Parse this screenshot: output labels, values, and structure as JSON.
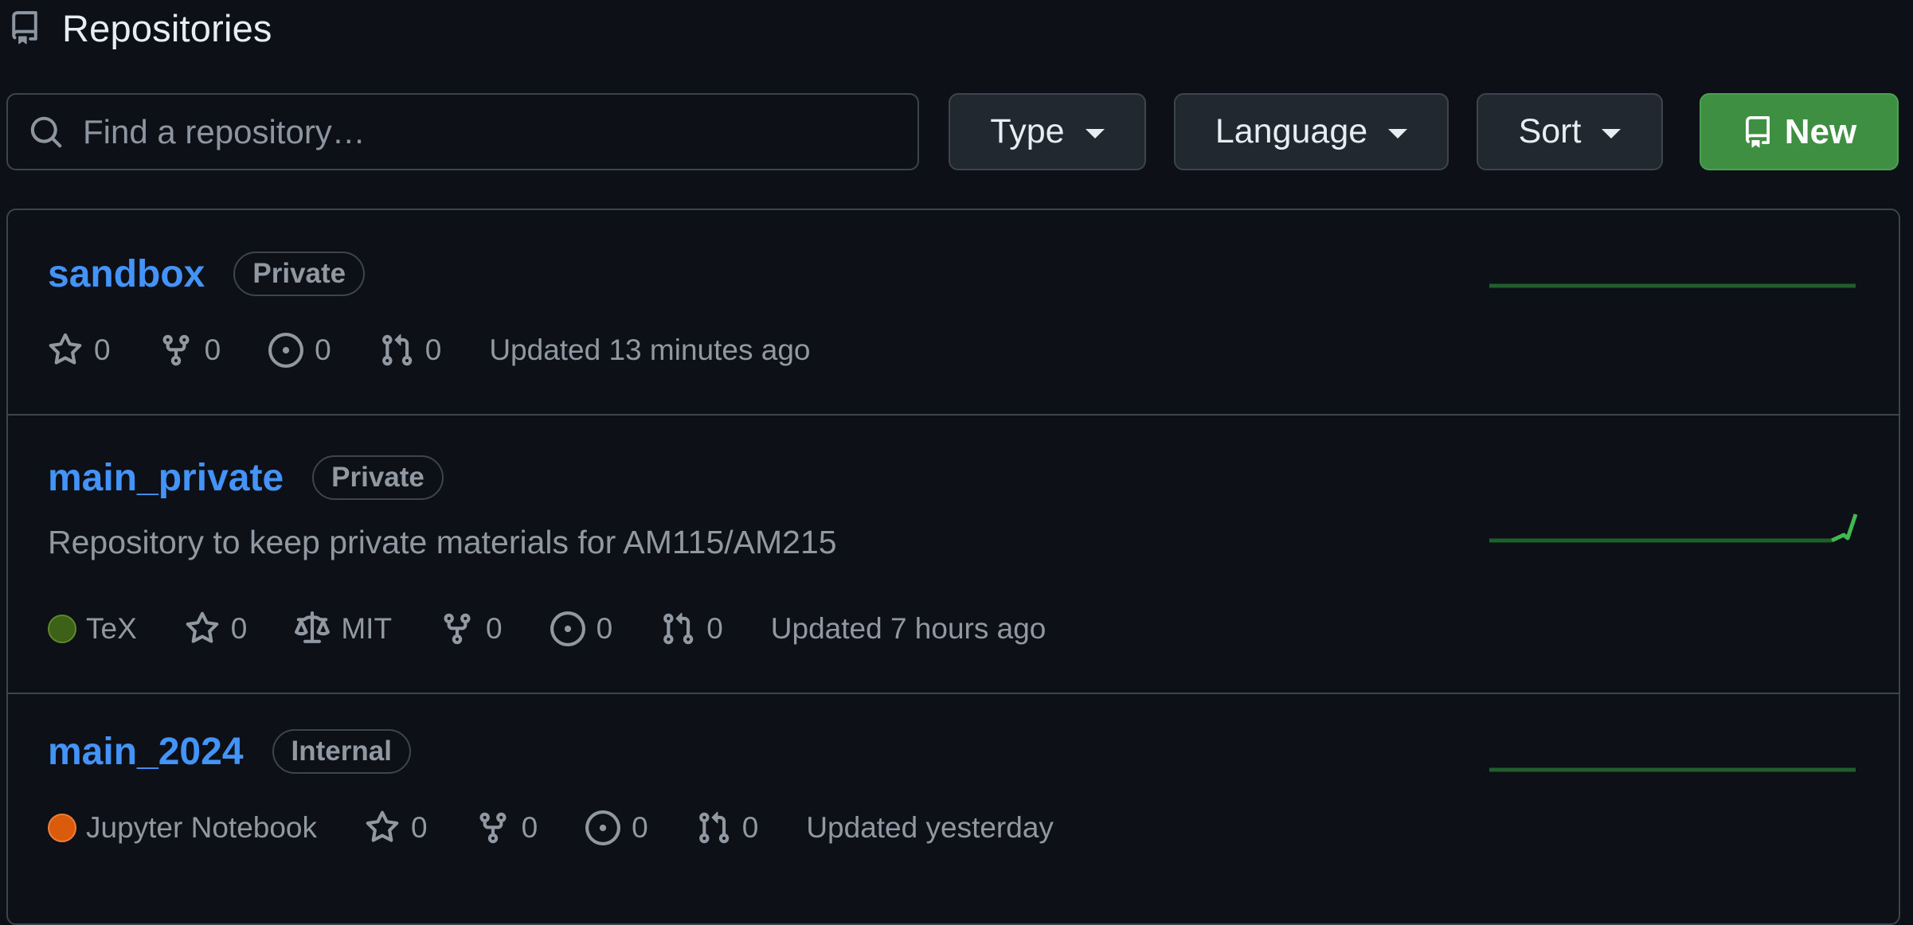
{
  "header": {
    "title": "Repositories",
    "icon": "repo-icon"
  },
  "search": {
    "placeholder": "Find a repository…",
    "value": "",
    "icon": "search-icon"
  },
  "filters": {
    "type_label": "Type",
    "language_label": "Language",
    "sort_label": "Sort",
    "new_label": "New"
  },
  "colors": {
    "background": "#0d1117",
    "link": "#4493f8",
    "new_button": "#3f8f43",
    "activity_line": "#1f5f2b",
    "activity_spike": "#3fb950",
    "tex": "#3d6117",
    "jupyter": "#da5b0b"
  },
  "repos": [
    {
      "name": "sandbox",
      "visibility": "Private",
      "description": "",
      "language": "",
      "license": "",
      "stars": "0",
      "forks": "0",
      "issues": "0",
      "pulls": "0",
      "updated": "Updated 13 minutes ago"
    },
    {
      "name": "main_private",
      "visibility": "Private",
      "description": "Repository to keep private materials for AM115/AM215",
      "language": "TeX",
      "license": "MIT",
      "stars": "0",
      "forks": "0",
      "issues": "0",
      "pulls": "0",
      "updated": "Updated 7 hours ago"
    },
    {
      "name": "main_2024",
      "visibility": "Internal",
      "description": "",
      "language": "Jupyter Notebook",
      "license": "",
      "stars": "0",
      "forks": "0",
      "issues": "0",
      "pulls": "0",
      "updated": "Updated yesterday"
    }
  ]
}
